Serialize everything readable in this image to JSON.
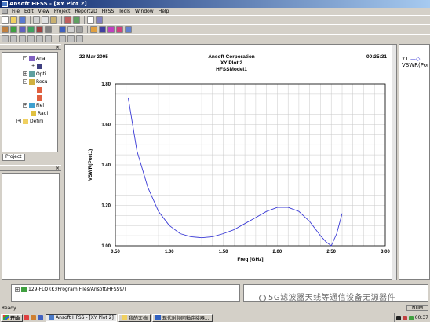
{
  "window": {
    "title": "Ansoft HFSS - [XY Plot 2]"
  },
  "menu": [
    "File",
    "Edit",
    "View",
    "Project",
    "Report2D",
    "HFSS",
    "Tools",
    "Window",
    "Help"
  ],
  "project_tree": {
    "items": [
      "Anal",
      "Opti",
      "Resu",
      "Fiel",
      "Radi",
      "Defini"
    ],
    "tab_label": "Project"
  },
  "plot": {
    "header_date": "22 Mar 2005",
    "header_company": "Ansoft Corporation",
    "header_plotname": "XY Plot 2",
    "header_model": "HFSSModel1",
    "header_time": "00:35:31"
  },
  "chart_data": {
    "type": "line",
    "xlabel": "Freq [GHz]",
    "ylabel": "VSWR(Port1)",
    "xlim": [
      0.5,
      3.0
    ],
    "ylim": [
      1.0,
      1.8
    ],
    "xticks": [
      "0.50",
      "1.00",
      "1.50",
      "2.00",
      "2.50",
      "3.00"
    ],
    "yticks": [
      "1.00",
      "1.20",
      "1.40",
      "1.60",
      "1.80"
    ],
    "grid": true,
    "series": [
      {
        "color": "#3a3ad6",
        "x": [
          0.62,
          0.7,
          0.8,
          0.9,
          1.0,
          1.1,
          1.2,
          1.3,
          1.4,
          1.5,
          1.6,
          1.7,
          1.8,
          1.9,
          2.0,
          2.1,
          2.2,
          2.3,
          2.4,
          2.45,
          2.5,
          2.55,
          2.6
        ],
        "y": [
          1.73,
          1.47,
          1.29,
          1.17,
          1.1,
          1.06,
          1.045,
          1.04,
          1.045,
          1.06,
          1.08,
          1.11,
          1.14,
          1.17,
          1.19,
          1.19,
          1.17,
          1.12,
          1.05,
          1.02,
          1.0,
          1.06,
          1.16
        ]
      }
    ]
  },
  "right_panel": {
    "legend_label": "Y1",
    "trace_label": "VSWR(Port1"
  },
  "message": {
    "path_text": "129-FLQ (K:/Program Files/Ansoft/HFSS9/)"
  },
  "watermark": "5G滤波器天线等通信设备无源器件",
  "status": {
    "text": "Ready",
    "num": "NUM"
  },
  "taskbar": {
    "start": "开始",
    "tasks": [
      "Ansoft HFSS - [XY Plot 2]",
      "我的文档",
      "现代射频同轴连接器..."
    ],
    "clock": "00:37"
  }
}
